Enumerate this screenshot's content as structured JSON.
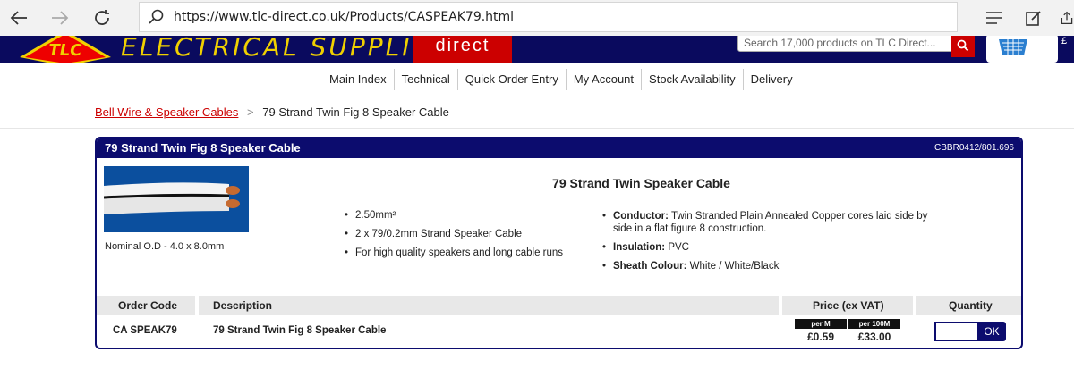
{
  "browser": {
    "url": "https://www.tlc-direct.co.uk/Products/CASPEAK79.html",
    "icons": [
      "back-arrow-icon",
      "forward-arrow-icon",
      "refresh-icon",
      "search-icon",
      "hamburger-menu-icon",
      "note-icon",
      "share-icon"
    ]
  },
  "header": {
    "logo_text": "TLC",
    "brand": "ELECTRICAL SUPPLIES",
    "brand_suffix": "direct",
    "search_placeholder": "Search 17,000 products on TLC Direct...",
    "basket_total": "£"
  },
  "nav": {
    "items": [
      "Main Index",
      "Technical",
      "Quick Order Entry",
      "My Account",
      "Stock Availability",
      "Delivery"
    ]
  },
  "breadcrumb": {
    "parent": "Bell Wire & Speaker Cables",
    "separator": ">",
    "current": "79 Strand Twin Fig 8 Speaker Cable"
  },
  "product": {
    "panel_title": "79 Strand Twin Fig 8 Speaker Cable",
    "panel_code": "CBBR0412/801.696",
    "image_caption": "Nominal O.D - 4.0 x 8.0mm",
    "title": "79 Strand Twin Speaker Cable",
    "features": [
      "2.50mm²",
      "2 x 79/0.2mm Strand Speaker Cable",
      "For high quality speakers and long cable runs"
    ],
    "specs": [
      {
        "label": "Conductor:",
        "value": "Twin Stranded Plain Annealed Copper cores laid side by side in a flat figure 8 construction."
      },
      {
        "label": "Insulation:",
        "value": "PVC"
      },
      {
        "label": "Sheath Colour:",
        "value": "White / White/Black"
      }
    ]
  },
  "order": {
    "headers": {
      "code": "Order Code",
      "description": "Description",
      "price": "Price (ex VAT)",
      "quantity": "Quantity"
    },
    "row": {
      "code": "CA SPEAK79",
      "description": "79 Strand Twin Fig 8 Speaker Cable",
      "price_unit_1": "per M",
      "price_1": "£0.59",
      "price_unit_2": "per 100M",
      "price_2": "£33.00",
      "quantity_value": "",
      "ok_label": "OK"
    }
  },
  "colors": {
    "navy": "#0c0c6e",
    "red": "#c00000",
    "yellow": "#f0d000"
  }
}
